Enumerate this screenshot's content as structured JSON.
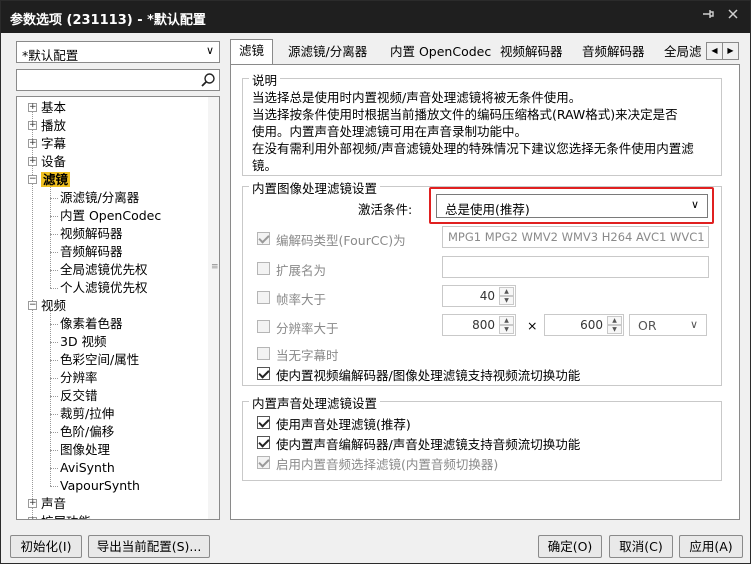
{
  "window": {
    "title": "参数选项 (231113) - *默认配置",
    "pin_icon": "pin-icon",
    "close_icon": "close-icon"
  },
  "sidebar": {
    "profile": "*默认配置",
    "search_placeholder": "",
    "tree": [
      {
        "label": "基本",
        "expand": "+"
      },
      {
        "label": "播放",
        "expand": "+"
      },
      {
        "label": "字幕",
        "expand": "+"
      },
      {
        "label": "设备",
        "expand": "+"
      },
      {
        "label": "滤镜",
        "expand": "−",
        "selected": true
      },
      {
        "label": "源滤镜/分离器"
      },
      {
        "label": "内置 OpenCodec"
      },
      {
        "label": "视频解码器"
      },
      {
        "label": "音频解码器"
      },
      {
        "label": "全局滤镜优先权"
      },
      {
        "label": "个人滤镜优先权"
      },
      {
        "label": "视频",
        "expand": "−"
      },
      {
        "label": "像素着色器"
      },
      {
        "label": "3D 视频"
      },
      {
        "label": "色彩空间/属性"
      },
      {
        "label": "分辨率"
      },
      {
        "label": "反交错"
      },
      {
        "label": "裁剪/拉伸"
      },
      {
        "label": "色阶/偏移"
      },
      {
        "label": "图像处理"
      },
      {
        "label": "AviSynth"
      },
      {
        "label": "VapourSynth"
      },
      {
        "label": "声音",
        "expand": "+"
      },
      {
        "label": "扩展功能",
        "expand": "+"
      }
    ]
  },
  "tabs": [
    "滤镜",
    "源滤镜/分离器",
    "内置 OpenCodec",
    "视频解码器",
    "音频解码器",
    "全局滤"
  ],
  "description": {
    "title": "说明",
    "lines": [
      "当选择总是使用时内置视频/声音处理滤镜将被无条件使用。",
      "当选择按条件使用时根据当前播放文件的编码压缩格式(RAW格式)来决定是否",
      "使用。内置声音处理滤镜可用在声音录制功能中。",
      "在没有需利用外部视频/声音滤镜处理的特殊情况下建议您选择无条件使用内置滤",
      "镜。"
    ]
  },
  "video_group": {
    "title": "内置图像处理滤镜设置",
    "activation_label": "激活条件:",
    "activation_value": "总是使用(推荐)",
    "fourcc_label": "编解码类型(FourCC)为",
    "fourcc_value": "MPG1 MPG2 WMV2 WMV3 H264 AVC1 WVC1",
    "ext_label": "扩展名为",
    "ext_value": "",
    "fps_label": "帧率大于",
    "fps_value": "40",
    "res_label": "分辨率大于",
    "res_w": "800",
    "times": "×",
    "res_h": "600",
    "res_op": "OR",
    "nosub_label": "当无字幕时",
    "switch_label": "使内置视频编解码器/图像处理滤镜支持视频流切换功能"
  },
  "audio_group": {
    "title": "内置声音处理滤镜设置",
    "use_label": "使用声音处理滤镜(推荐)",
    "switch_label": "使内置声音编解码器/声音处理滤镜支持音频流切换功能",
    "selector_label": "启用内置音频选择滤镜(内置音频切换器)"
  },
  "footer": {
    "init": "初始化(I)",
    "export": "导出当前配置(S)...",
    "ok": "确定(O)",
    "cancel": "取消(C)",
    "apply": "应用(A)"
  },
  "colors": {
    "titlebar": "#1f1f1f",
    "selection": "#f0c020",
    "highlight": "#e02020"
  }
}
